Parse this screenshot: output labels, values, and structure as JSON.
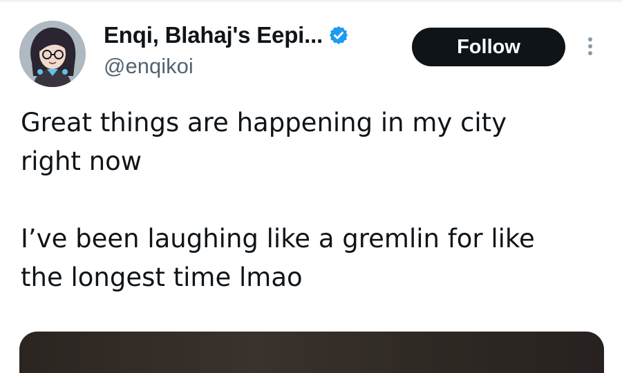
{
  "tweet": {
    "author": {
      "display_name": "Enqi, Blahaj's Eepi...",
      "handle": "@enqikoi",
      "verified": true
    },
    "follow_label": "Follow",
    "text": "Great things are happening in my city\nright now\n\nI’ve been laughing like a gremlin for like\nthe longest time lmao"
  },
  "colors": {
    "follow_button_bg": "#0f1419",
    "verified_badge": "#1d9bf0",
    "handle_text": "#536471"
  }
}
